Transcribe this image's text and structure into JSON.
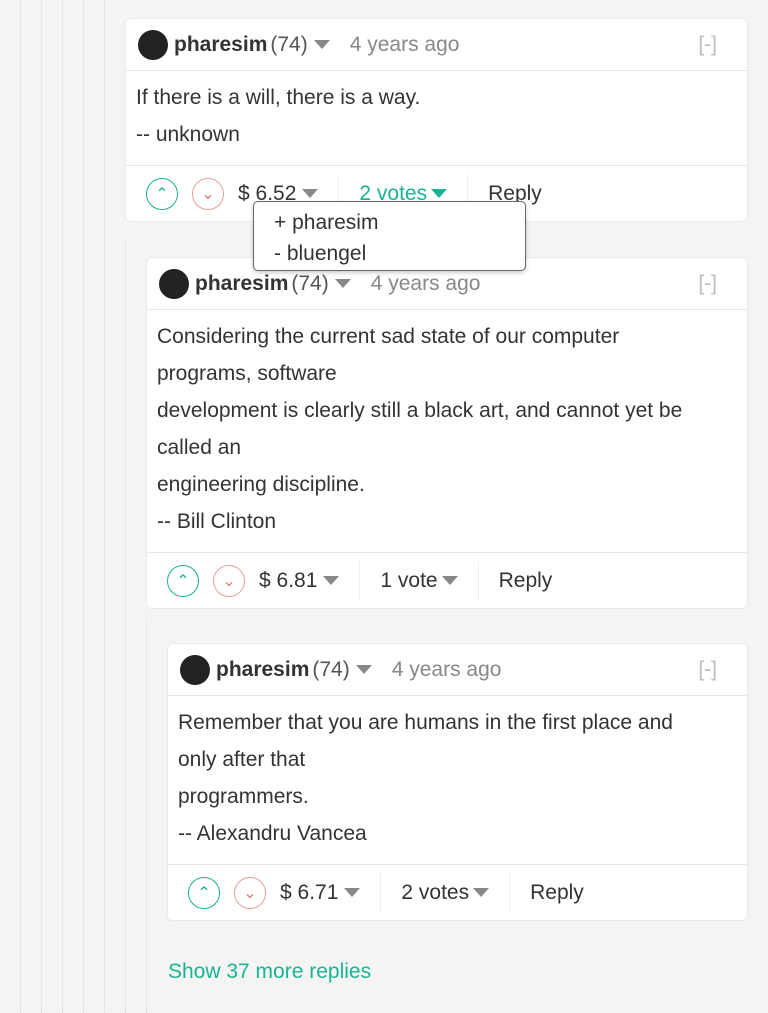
{
  "colors": {
    "accent": "#1ab394",
    "downvote": "#e07b73",
    "background": "#f4f4f4"
  },
  "comments": [
    {
      "author": "pharesim",
      "reputation": "(74)",
      "time": "4 years ago",
      "collapse": "[-]",
      "lines": [
        "If there is a will, there is a way.",
        "-- unknown"
      ],
      "payout": "$ 6.52",
      "votes": "2 votes",
      "reply": "Reply",
      "upvote_icon": "chevron-up-circle",
      "downvote_icon": "chevron-down-circle"
    },
    {
      "author": "pharesim",
      "reputation": "(74)",
      "time": "4 years ago",
      "collapse": "[-]",
      "lines": [
        "Considering the current sad state of our computer",
        "programs, software",
        "development is clearly still a black art, and cannot yet be",
        "called an",
        "engineering discipline.",
        "-- Bill Clinton"
      ],
      "payout": "$ 6.81",
      "votes": "1 vote",
      "reply": "Reply"
    },
    {
      "author": "pharesim",
      "reputation": "(74)",
      "time": "4 years ago",
      "collapse": "[-]",
      "lines": [
        "Remember that you are humans in the first place and",
        "only after that",
        "programmers.",
        "-- Alexandru Vancea"
      ],
      "payout": "$ 6.71",
      "votes": "2 votes",
      "reply": "Reply"
    }
  ],
  "voters_popup": [
    "+ pharesim",
    "- bluengel"
  ],
  "show_more": "Show 37 more replies"
}
